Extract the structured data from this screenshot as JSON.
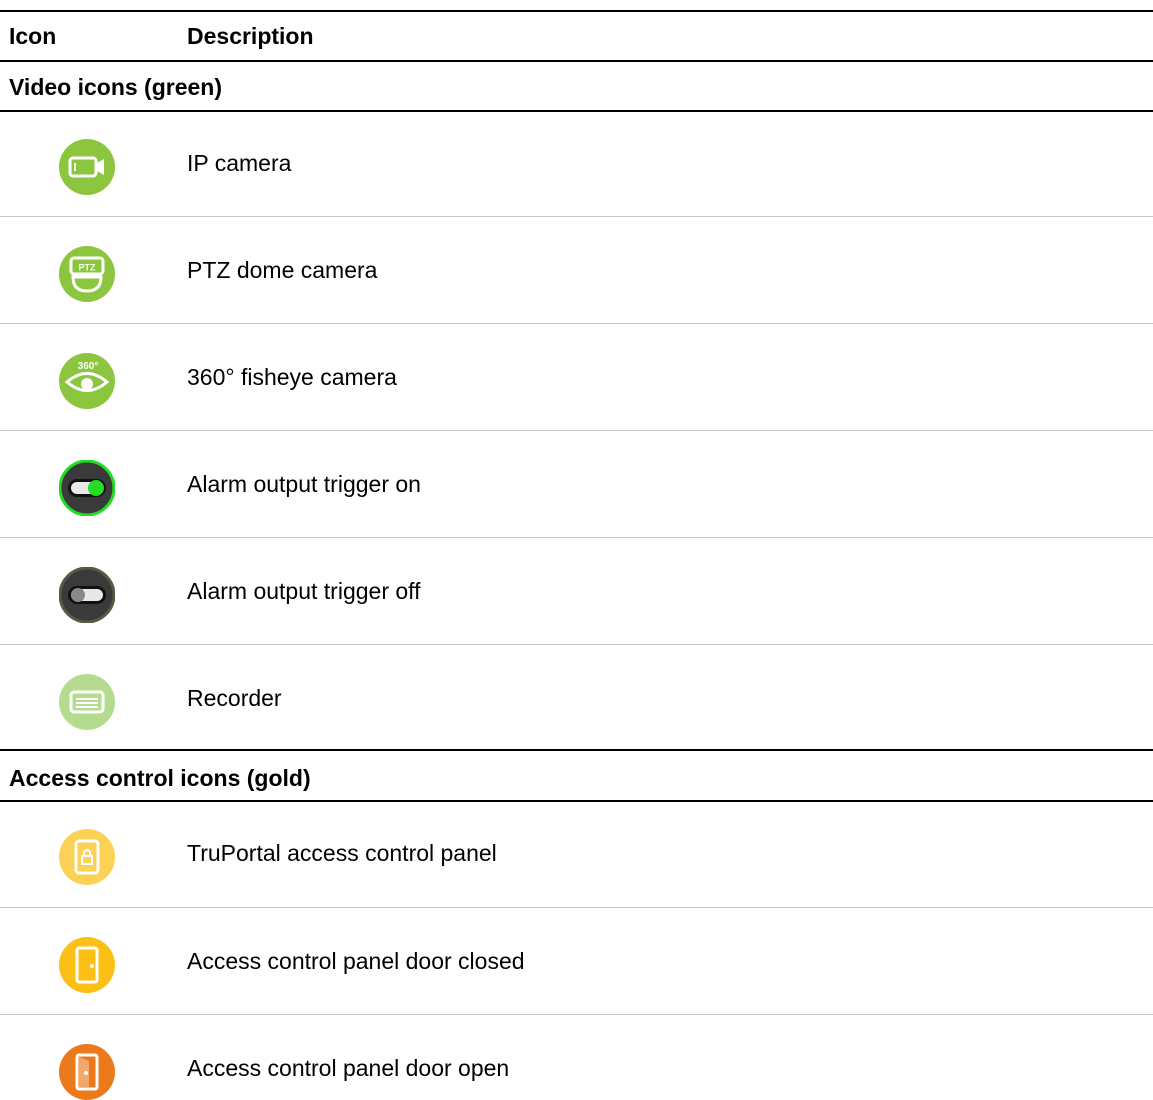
{
  "table": {
    "header": {
      "icon_col": "Icon",
      "description_col": "Description"
    },
    "sections": [
      {
        "title": "Video icons (green)",
        "rows": [
          {
            "icon": "ip-camera-icon",
            "description": "IP camera"
          },
          {
            "icon": "ptz-dome-camera-icon",
            "icon_text": "PTZ",
            "description": "PTZ dome camera"
          },
          {
            "icon": "fisheye-camera-icon",
            "icon_text": "360°",
            "description": "360° fisheye camera"
          },
          {
            "icon": "toggle-on-icon",
            "description": "Alarm output trigger on"
          },
          {
            "icon": "toggle-off-icon",
            "description": "Alarm output trigger off"
          },
          {
            "icon": "recorder-icon",
            "description": "Recorder"
          }
        ]
      },
      {
        "title": "Access control icons (gold)",
        "rows": [
          {
            "icon": "access-panel-lock-icon",
            "description": "TruPortal access control panel"
          },
          {
            "icon": "door-closed-icon",
            "description": "Access control panel door closed"
          },
          {
            "icon": "door-open-icon",
            "description": "Access control panel door open"
          }
        ]
      }
    ]
  },
  "colors": {
    "video_green": "#8cc63f",
    "recorder_green": "#b5dc8e",
    "toggle_dark": "#3a3a3a",
    "toggle_on": "#22dd22",
    "access_gold_light": "#fbd256",
    "access_gold": "#fbbf16",
    "access_orange": "#ec7a1c"
  }
}
